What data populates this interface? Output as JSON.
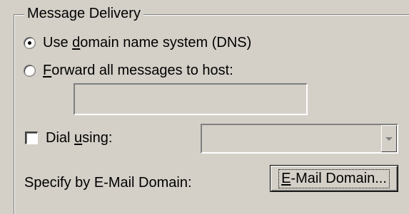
{
  "group": {
    "title": "Message Delivery"
  },
  "delivery": {
    "dns_option": {
      "pre": "Use ",
      "accel": "d",
      "post": "omain name system (DNS)",
      "selected": true
    },
    "forward_option": {
      "pre": "",
      "accel": "F",
      "post": "orward all messages to host:",
      "selected": false
    },
    "host_field": {
      "value": "",
      "enabled": false
    },
    "dial": {
      "pre": "Dial ",
      "accel": "u",
      "post": "sing:",
      "checked": false
    },
    "dial_combo": {
      "value": "",
      "enabled": false
    },
    "email_domain": {
      "label": "Specify by E-Mail Domain:",
      "button": {
        "accel": "E",
        "post": "-Mail Domain..."
      }
    }
  }
}
